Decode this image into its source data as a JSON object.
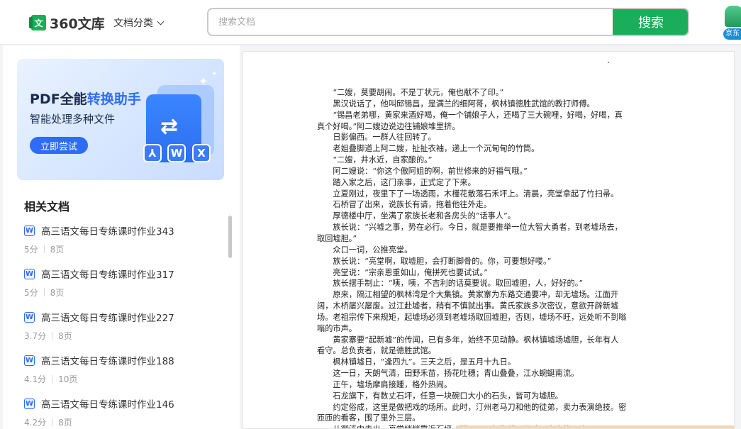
{
  "header": {
    "logo_glyph": "文",
    "logo_text": "360文库",
    "category_label": "文档分类",
    "search_placeholder": "搜索文档",
    "search_button": "搜索",
    "jd_label": "京东"
  },
  "banner": {
    "title_prefix": "PDF全能",
    "title_highlight": "转换助手",
    "subtitle": "智能处理多种文件",
    "button": "立即尝试",
    "fmt_pdf": "⅄",
    "fmt_word": "W",
    "fmt_excel": "X"
  },
  "related": {
    "heading": "相关文档",
    "items": [
      {
        "icon": "W",
        "title": "高三语文每日专练课时作业343",
        "score": "5分",
        "pages": "8页"
      },
      {
        "icon": "W",
        "title": "高三语文每日专练课时作业317",
        "score": "5分",
        "pages": "8页"
      },
      {
        "icon": "W",
        "title": "高三语文每日专练课时作业227",
        "score": "3.7分",
        "pages": "8页"
      },
      {
        "icon": "W",
        "title": "高三语文每日专练课时作业188",
        "score": "4.1分",
        "pages": "10页"
      },
      {
        "icon": "W",
        "title": "高三语文每日专练课时作业146",
        "score": "4.2分",
        "pages": "8页"
      }
    ]
  },
  "document": {
    "lines": [
      {
        "text": "“二嫂，莫要胡闹。不是丁状元，俺也献不了印。”",
        "indent": true
      },
      {
        "text": "黑汉说话了，他叫邱锡昌，是满兰的细阿哥，枫林镇德胜武馆的教打师傅。",
        "indent": true
      },
      {
        "text": "“锡昌老弟哪，黄家来酒好喝，俺一个铺娘子人，还喝了三大碗哩，好喝，好喝，真",
        "indent": true
      },
      {
        "text": "真个好喝。”阿二嫂边说边往铺娘堆里挤。",
        "indent": false
      },
      {
        "text": "日影偏西。一群人往回转了。",
        "indent": true
      },
      {
        "text": "老姐叠脚道上阿二嫂，扯扯衣袖，递上一个沉甸甸的竹筒。",
        "indent": true
      },
      {
        "text": "“二嫂，井水近，自家酿的。”",
        "indent": true
      },
      {
        "text": "阿二嫂说：“你这个傲阿姐的啊，前世修来的好福气哦。”",
        "indent": true
      },
      {
        "text": "踏入家之后，这门亲事，正式定了下来。",
        "indent": true
      },
      {
        "text": "立夏刚过，夜里下了一场透雨，木槿花散落石禾坪上。清晨，亮堂拿起了竹扫帚。",
        "indent": true
      },
      {
        "text": "石桥冒了出来，说族长有请，拖着他往外走。",
        "indent": true
      },
      {
        "text": "厚德楼中厅，坐满了家族长老和各房头的“话事人”。",
        "indent": true
      },
      {
        "text": "族长说：“兴墟之事，势在必行。今日，就是要推举一位大智大勇者，到老墟场去，",
        "indent": true
      },
      {
        "text": "取回墟胆。”",
        "indent": false
      },
      {
        "text": "众口一词，公推亮堂。",
        "indent": true
      },
      {
        "text": "族长说：“亮堂啊，取墟胆，会打断脚骨的。你，可要想好喽。”",
        "indent": true
      },
      {
        "text": "亮堂说：“宗亲恩重如山，俺拼死也要试试。”",
        "indent": true
      },
      {
        "text": "族长摆手制止：“咦，咦，不吉利的话莫要说。取回墟胆，人，好好的。”",
        "indent": true
      },
      {
        "text": "原来，隔江相望的枫林湾是个大集镇。黄家寨为东路交通要冲，却无墟场。江面开",
        "indent": true
      },
      {
        "text": "阔，木桥屡兴屡废。过江赴墟者，稍有不慎就出事。黄氏家族多次密议，意欲开辟新墟",
        "indent": false
      },
      {
        "text": "场。老祖宗传下来规矩，起墟场必须到老墟场取回墟胆，否则，墟场不旺，远处听不到嗡",
        "indent": false
      },
      {
        "text": "嗡的市声。",
        "indent": false
      },
      {
        "text": "黄家寨要“起新墟”的传闻，已有多年，始终不见动静。枫林镇墟场墟胆，长年有人",
        "indent": true
      },
      {
        "text": "看守。总负责者，就是德胜武馆。",
        "indent": false
      },
      {
        "text": "枫林镇墟日，“逢四九”。三天之后，是五月十九日。",
        "indent": true
      },
      {
        "text": "这一日，天朗气清，田野禾苗，扬花吐穗；青山叠叠，江水蜿蜒南流。",
        "indent": true
      },
      {
        "text": "正午，墟场摩肩接踵，格外热闹。",
        "indent": true
      },
      {
        "text": "石龙旗下，有数丈石坪，任意一块碗口大小的石头，皆可为墟胆。",
        "indent": true
      },
      {
        "text": "约定俗成，这里是做把戏的场所。此时，汀州老马刀和他的徒弟，卖力表演绝技。密",
        "indent": true
      },
      {
        "text": "匝匝的看客，围了里外三层。",
        "indent": false
      },
      {
        "text": "从御溪中走出，亮堂悄悄靠近石坪。蹲下，一把抱起一块碗口大小的石头，",
        "indent": true
      }
    ]
  }
}
